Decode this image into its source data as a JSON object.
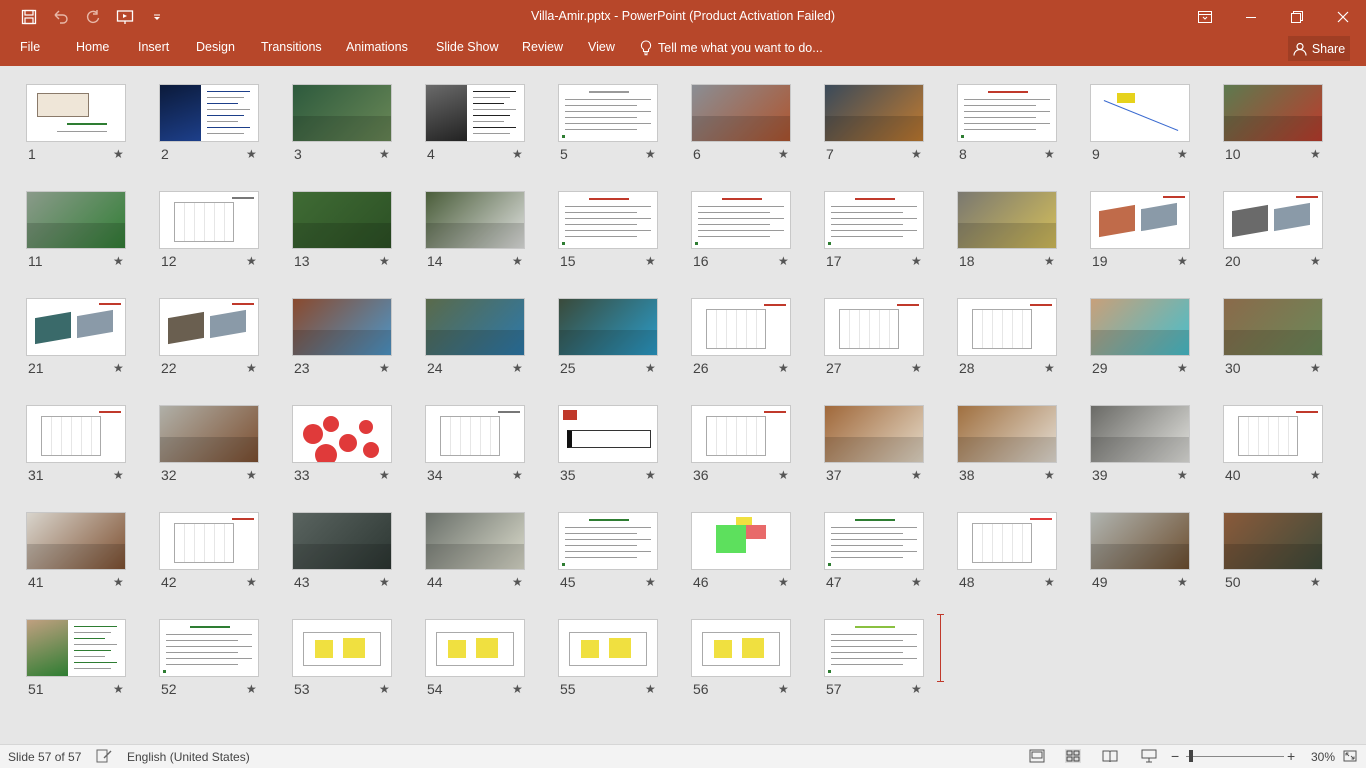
{
  "window": {
    "title": "Villa-Amir.pptx - PowerPoint (Product Activation Failed)"
  },
  "qat": {
    "icons": [
      "save-icon",
      "undo-icon",
      "redo-icon",
      "present-from-start-icon",
      "customize-qat-icon"
    ]
  },
  "ribbon": {
    "tabs": [
      "File",
      "Home",
      "Insert",
      "Design",
      "Transitions",
      "Animations",
      "Slide Show",
      "Review",
      "View"
    ],
    "tell_me": "Tell me what you want to do...",
    "share": "Share"
  },
  "slides": [
    {
      "n": "1",
      "kind": "cover",
      "bg": "#f4f7f0",
      "accent": "#2e7d32"
    },
    {
      "n": "2",
      "kind": "photo-text",
      "bg": "#0b1a3a",
      "accent": "#1d3f8a"
    },
    {
      "n": "3",
      "kind": "photo",
      "bg": "#2d5a3d",
      "accent": "#6d8a58"
    },
    {
      "n": "4",
      "kind": "photo-text",
      "bg": "#6a6a6a",
      "accent": "#222222"
    },
    {
      "n": "5",
      "kind": "text",
      "bg": "#ffffff",
      "accent": "#9a9a9a"
    },
    {
      "n": "6",
      "kind": "photo",
      "bg": "#8a8e94",
      "accent": "#b0522a"
    },
    {
      "n": "7",
      "kind": "photo",
      "bg": "#3a4a5a",
      "accent": "#c77d2e"
    },
    {
      "n": "8",
      "kind": "text",
      "bg": "#ffffff",
      "accent": "#c0392b"
    },
    {
      "n": "9",
      "kind": "diagram",
      "bg": "#ffffff",
      "accent": "#e6d21c"
    },
    {
      "n": "10",
      "kind": "photo",
      "bg": "#5d7a4f",
      "accent": "#c0392b"
    },
    {
      "n": "11",
      "kind": "photo",
      "bg": "#8a9a8a",
      "accent": "#2e7d32"
    },
    {
      "n": "12",
      "kind": "plan",
      "bg": "#ffffff",
      "accent": "#777777"
    },
    {
      "n": "13",
      "kind": "photo",
      "bg": "#3f6b34",
      "accent": "#2b4f24"
    },
    {
      "n": "14",
      "kind": "photo",
      "bg": "#4a5d3a",
      "accent": "#e8e8e8"
    },
    {
      "n": "15",
      "kind": "text",
      "bg": "#ffffff",
      "accent": "#c0392b"
    },
    {
      "n": "16",
      "kind": "text",
      "bg": "#ffffff",
      "accent": "#c0392b"
    },
    {
      "n": "17",
      "kind": "text",
      "bg": "#ffffff",
      "accent": "#c0392b"
    },
    {
      "n": "18",
      "kind": "photo",
      "bg": "#7a7870",
      "accent": "#d8c25a"
    },
    {
      "n": "19",
      "kind": "model",
      "bg": "#ffffff",
      "accent": "#c06b4a"
    },
    {
      "n": "20",
      "kind": "model",
      "bg": "#ffffff",
      "accent": "#6a6a6a"
    },
    {
      "n": "21",
      "kind": "model",
      "bg": "#ffffff",
      "accent": "#3a6a6a"
    },
    {
      "n": "22",
      "kind": "model",
      "bg": "#ffffff",
      "accent": "#6a5f50"
    },
    {
      "n": "23",
      "kind": "photo",
      "bg": "#8a4a2e",
      "accent": "#4a9ad0"
    },
    {
      "n": "24",
      "kind": "photo",
      "bg": "#5a6a4a",
      "accent": "#2a7ab0"
    },
    {
      "n": "25",
      "kind": "photo",
      "bg": "#3a4a3a",
      "accent": "#2aa0d0"
    },
    {
      "n": "26",
      "kind": "sketch",
      "bg": "#ffffff",
      "accent": "#c0392b"
    },
    {
      "n": "27",
      "kind": "sketch",
      "bg": "#ffffff",
      "accent": "#c0392b"
    },
    {
      "n": "28",
      "kind": "sketch",
      "bg": "#ffffff",
      "accent": "#c0392b"
    },
    {
      "n": "29",
      "kind": "photo",
      "bg": "#c8a07a",
      "accent": "#40c0d0"
    },
    {
      "n": "30",
      "kind": "photo",
      "bg": "#8a6a4a",
      "accent": "#6a8a5a"
    },
    {
      "n": "31",
      "kind": "plan",
      "bg": "#ffffff",
      "accent": "#c0392b"
    },
    {
      "n": "32",
      "kind": "photo",
      "bg": "#b0b0a8",
      "accent": "#7a4a2a"
    },
    {
      "n": "33",
      "kind": "bubbles",
      "bg": "#ffffff",
      "accent": "#e03a3a"
    },
    {
      "n": "34",
      "kind": "plan",
      "bg": "#ffffff",
      "accent": "#777777"
    },
    {
      "n": "35",
      "kind": "section",
      "bg": "#ffffff",
      "accent": "#c0392b"
    },
    {
      "n": "36",
      "kind": "plan",
      "bg": "#ffffff",
      "accent": "#c0392b"
    },
    {
      "n": "37",
      "kind": "photo",
      "bg": "#a0683a",
      "accent": "#e8e0d0"
    },
    {
      "n": "38",
      "kind": "photo",
      "bg": "#a07040",
      "accent": "#e8e4dc"
    },
    {
      "n": "39",
      "kind": "photo",
      "bg": "#6a6a66",
      "accent": "#e8e8e4"
    },
    {
      "n": "40",
      "kind": "plan",
      "bg": "#ffffff",
      "accent": "#c0392b"
    },
    {
      "n": "41",
      "kind": "photo",
      "bg": "#d8d4cc",
      "accent": "#7a4a2a"
    },
    {
      "n": "42",
      "kind": "plan",
      "bg": "#ffffff",
      "accent": "#c0392b"
    },
    {
      "n": "43",
      "kind": "photo",
      "bg": "#5a6460",
      "accent": "#2a3430"
    },
    {
      "n": "44",
      "kind": "photo",
      "bg": "#6a706a",
      "accent": "#e0e0d0"
    },
    {
      "n": "45",
      "kind": "text",
      "bg": "#ffffff",
      "accent": "#2e7d32"
    },
    {
      "n": "46",
      "kind": "colorplan",
      "bg": "#ffffff",
      "accent": "#5de05d"
    },
    {
      "n": "47",
      "kind": "text",
      "bg": "#ffffff",
      "accent": "#2e7d32"
    },
    {
      "n": "48",
      "kind": "plan",
      "bg": "#ffffff",
      "accent": "#e03a3a"
    },
    {
      "n": "49",
      "kind": "photo",
      "bg": "#b0b4b0",
      "accent": "#6a4a2a"
    },
    {
      "n": "50",
      "kind": "photo",
      "bg": "#8a5a3a",
      "accent": "#3a4a3a"
    },
    {
      "n": "51",
      "kind": "photo-text",
      "bg": "#c0a080",
      "accent": "#2e7d32"
    },
    {
      "n": "52",
      "kind": "text",
      "bg": "#ffffff",
      "accent": "#2e7d32"
    },
    {
      "n": "53",
      "kind": "yellow",
      "bg": "#ffffff",
      "accent": "#f0e040"
    },
    {
      "n": "54",
      "kind": "yellow",
      "bg": "#ffffff",
      "accent": "#f0e040"
    },
    {
      "n": "55",
      "kind": "yellow",
      "bg": "#ffffff",
      "accent": "#f0e040"
    },
    {
      "n": "56",
      "kind": "yellow",
      "bg": "#ffffff",
      "accent": "#f0e040"
    },
    {
      "n": "57",
      "kind": "text",
      "bg": "#ffffff",
      "accent": "#8ac040"
    }
  ],
  "status": {
    "slide_info": "Slide 57 of 57",
    "language": "English (United States)",
    "zoom": "30%",
    "zoom_minus": "−",
    "zoom_plus": "+"
  },
  "colors": {
    "ribbon": "#b7472a",
    "sorter_bg": "#e6e6e6",
    "insert_marker": "#c0392b"
  }
}
